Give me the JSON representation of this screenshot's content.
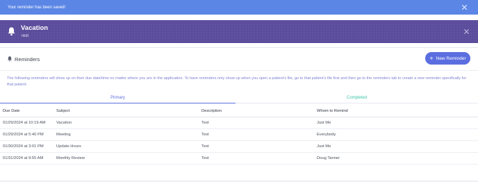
{
  "toast": {
    "message": "Your reminder has been saved!"
  },
  "banner": {
    "title": "Vacation",
    "subtitle": "Test"
  },
  "reminders": {
    "header": "Reminders",
    "new_button_label": "New Reminder",
    "description": "The following reminders will show up on their due date/time no matter where you are in the application. To have reminders only show up when you open a patient's file, go to that patient's file first and then go to the reminders tab to create a new reminder specifically for that patient.",
    "tabs": [
      {
        "label": "Primary",
        "active": true
      },
      {
        "label": "Completed",
        "active": false
      }
    ],
    "columns": [
      "Due Date",
      "Subject",
      "Description",
      "Whom to Remind"
    ],
    "rows": [
      [
        "01/29/2024 at 10:19 AM",
        "Vacation",
        "Test",
        "Just Me"
      ],
      [
        "01/29/2024 at 5:40 PM",
        "Meeting",
        "Test",
        "Everybody"
      ],
      [
        "01/30/2024 at 3:01 PM",
        "Update Hours",
        "Test",
        "Just Me"
      ],
      [
        "01/31/2024 at 9:55 AM",
        "Monthly Review",
        "Test",
        "Doug Tanner"
      ]
    ]
  },
  "colors": {
    "toast_bg": "#5b86e5",
    "banner_bg": "#5b4d9c",
    "accent": "#5b6ee0",
    "completed_tab": "#3bc4a8"
  },
  "icons": {
    "toast_close": "close-icon",
    "banner_bell": "bell-icon",
    "banner_close": "close-icon",
    "header_bell": "bell-icon",
    "new_button": "plus-icon"
  }
}
